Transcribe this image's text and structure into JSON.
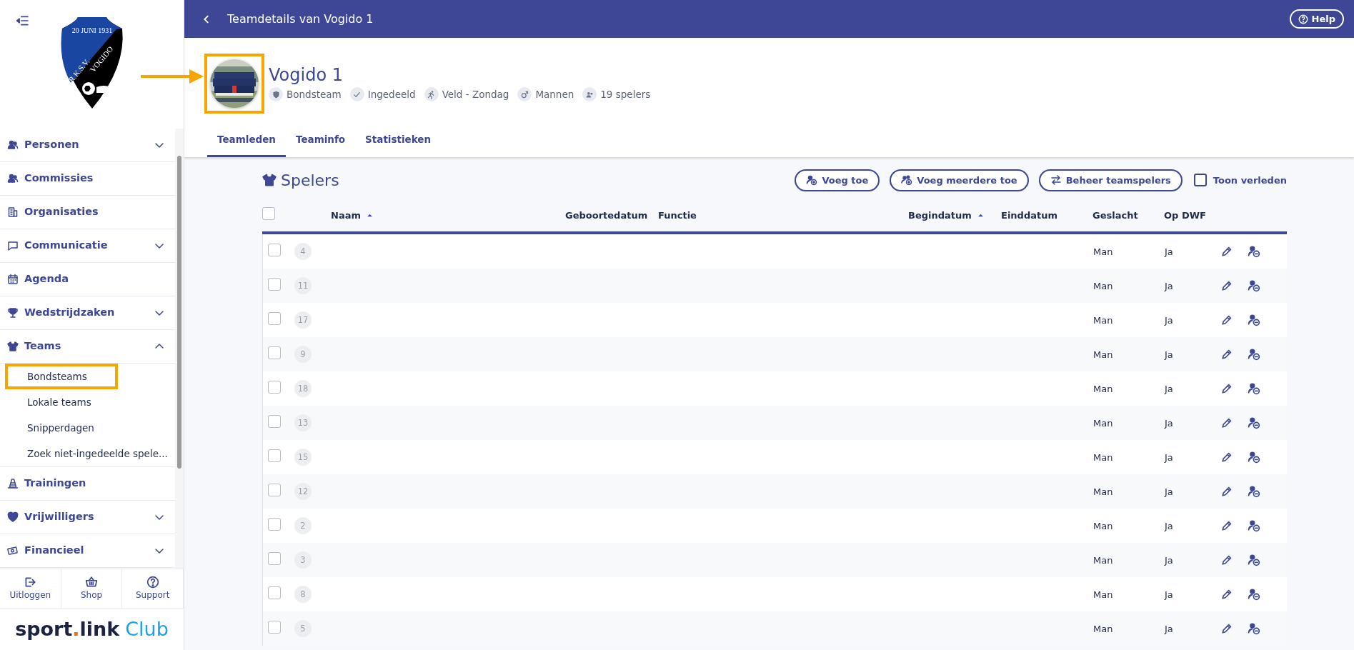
{
  "club": {
    "crest_top": "20 JUNI 1931",
    "crest_left": "R.K.S.V.",
    "crest_right": "VOGIDO"
  },
  "sidebar": {
    "items": [
      {
        "label": "Personen",
        "expandable": true,
        "expanded": false
      },
      {
        "label": "Commissies",
        "expandable": false
      },
      {
        "label": "Organisaties",
        "expandable": false
      },
      {
        "label": "Communicatie",
        "expandable": true,
        "expanded": false
      },
      {
        "label": "Agenda",
        "expandable": false
      },
      {
        "label": "Wedstrijdzaken",
        "expandable": true,
        "expanded": false
      },
      {
        "label": "Teams",
        "expandable": true,
        "expanded": true,
        "children": [
          {
            "label": "Bondsteams",
            "highlighted": true
          },
          {
            "label": "Lokale teams",
            "highlighted": false
          },
          {
            "label": "Snipperdagen",
            "highlighted": false
          },
          {
            "label": "Zoek niet-ingedeelde spele...",
            "highlighted": false
          }
        ]
      },
      {
        "label": "Trainingen",
        "expandable": false
      },
      {
        "label": "Vrijwilligers",
        "expandable": true,
        "expanded": false
      },
      {
        "label": "Financieel",
        "expandable": true,
        "expanded": false
      }
    ]
  },
  "footer_actions": [
    {
      "label": "Uitloggen"
    },
    {
      "label": "Shop"
    },
    {
      "label": "Support"
    }
  ],
  "brand": {
    "part1": "sport",
    "dot": ".",
    "part2": "link",
    "part3": "Club"
  },
  "topbar": {
    "title": "Teamdetails van Vogido 1",
    "help": "Help"
  },
  "team": {
    "name": "Vogido 1",
    "photo_highlighted": true,
    "meta": [
      "Bondsteam",
      "Ingedeeld",
      "Veld - Zondag",
      "Mannen",
      "19 spelers"
    ]
  },
  "tabs": [
    {
      "label": "Teamleden",
      "selected": true
    },
    {
      "label": "Teaminfo",
      "selected": false
    },
    {
      "label": "Statistieken",
      "selected": false
    }
  ],
  "section": {
    "title": "Spelers",
    "buttons": [
      "Voeg toe",
      "Voeg meerdere toe",
      "Beheer teamspelers"
    ],
    "show_past": {
      "label": "Toon verleden",
      "checked": false
    }
  },
  "table": {
    "all_checked": false,
    "columns": [
      {
        "label": "Naam",
        "sorted": true
      },
      {
        "label": "Geboortedatum",
        "sorted": false
      },
      {
        "label": "Functie",
        "sorted": false
      },
      {
        "label": "Begindatum",
        "sorted": true
      },
      {
        "label": "Einddatum",
        "sorted": false
      },
      {
        "label": "Geslacht",
        "sorted": false
      },
      {
        "label": "Op DWF",
        "sorted": false
      }
    ],
    "rows": [
      {
        "number": "4",
        "gender": "Man",
        "dwf": "Ja",
        "checked": false
      },
      {
        "number": "11",
        "gender": "Man",
        "dwf": "Ja",
        "checked": false
      },
      {
        "number": "17",
        "gender": "Man",
        "dwf": "Ja",
        "checked": false
      },
      {
        "number": "9",
        "gender": "Man",
        "dwf": "Ja",
        "checked": false
      },
      {
        "number": "18",
        "gender": "Man",
        "dwf": "Ja",
        "checked": false
      },
      {
        "number": "13",
        "gender": "Man",
        "dwf": "Ja",
        "checked": false
      },
      {
        "number": "15",
        "gender": "Man",
        "dwf": "Ja",
        "checked": false
      },
      {
        "number": "12",
        "gender": "Man",
        "dwf": "Ja",
        "checked": false
      },
      {
        "number": "2",
        "gender": "Man",
        "dwf": "Ja",
        "checked": false
      },
      {
        "number": "3",
        "gender": "Man",
        "dwf": "Ja",
        "checked": false
      },
      {
        "number": "8",
        "gender": "Man",
        "dwf": "Ja",
        "checked": false
      },
      {
        "number": "5",
        "gender": "Man",
        "dwf": "Ja",
        "checked": false
      }
    ]
  }
}
